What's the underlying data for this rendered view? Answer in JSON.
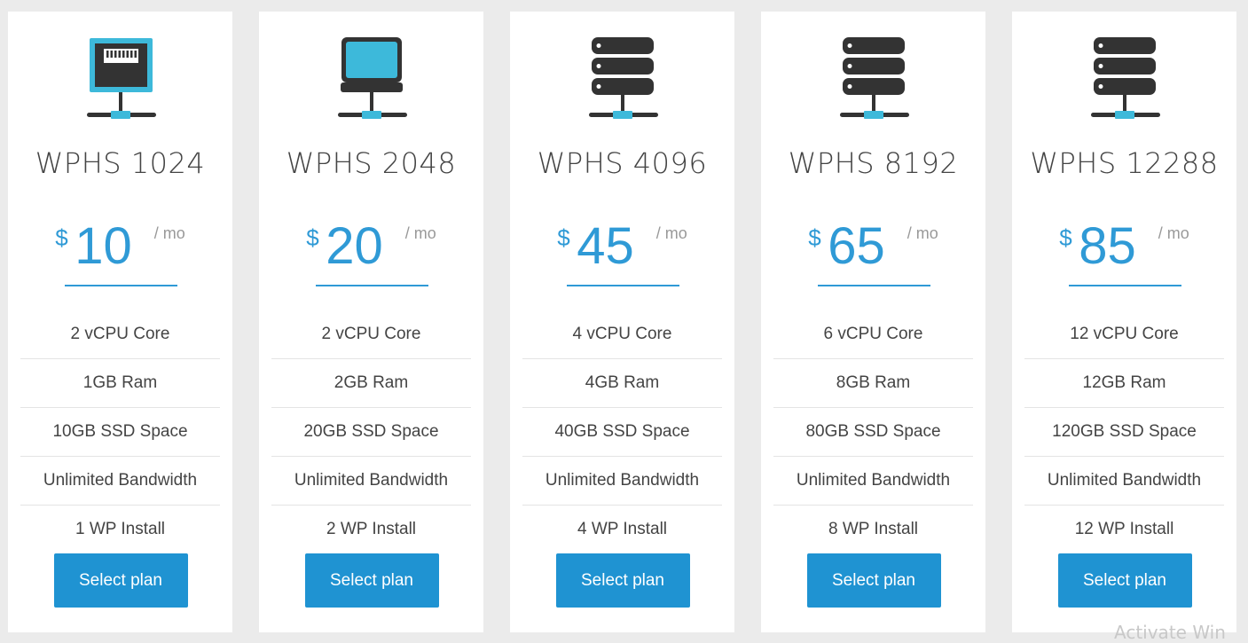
{
  "plans": [
    {
      "icon": "network-port-icon",
      "name": "WPHS 1024",
      "currency": "$",
      "price": "10",
      "period": "/ mo",
      "features": [
        "2 vCPU Core",
        "1GB Ram",
        "10GB SSD Space",
        "Unlimited Bandwidth",
        "1 WP Install"
      ],
      "button_label": "Select plan"
    },
    {
      "icon": "computer-monitor-icon",
      "name": "WPHS 2048",
      "currency": "$",
      "price": "20",
      "period": "/ mo",
      "features": [
        "2 vCPU Core",
        "2GB Ram",
        "20GB SSD Space",
        "Unlimited Bandwidth",
        "2 WP Install"
      ],
      "button_label": "Select plan"
    },
    {
      "icon": "server-stack-icon",
      "name": "WPHS 4096",
      "currency": "$",
      "price": "45",
      "period": "/ mo",
      "features": [
        "4 vCPU Core",
        "4GB Ram",
        "40GB SSD Space",
        "Unlimited Bandwidth",
        "4 WP Install"
      ],
      "button_label": "Select plan"
    },
    {
      "icon": "server-stack-icon",
      "name": "WPHS 8192",
      "currency": "$",
      "price": "65",
      "period": "/ mo",
      "features": [
        "6 vCPU Core",
        "8GB Ram",
        "80GB SSD Space",
        "Unlimited Bandwidth",
        "8 WP Install"
      ],
      "button_label": "Select plan"
    },
    {
      "icon": "server-stack-icon",
      "name": "WPHS 12288",
      "currency": "$",
      "price": "85",
      "period": "/ mo",
      "features": [
        "12 vCPU Core",
        "12GB Ram",
        "120GB SSD Space",
        "Unlimited Bandwidth",
        "12 WP Install"
      ],
      "button_label": "Select plan"
    }
  ],
  "watermark_text": "Activate Win",
  "colors": {
    "accent": "#1f93d2",
    "price_text": "#2f9ad6",
    "icon_dark": "#333333",
    "icon_light": "#3db9da",
    "page_background": "#ebebeb",
    "card_background": "#ffffff"
  }
}
